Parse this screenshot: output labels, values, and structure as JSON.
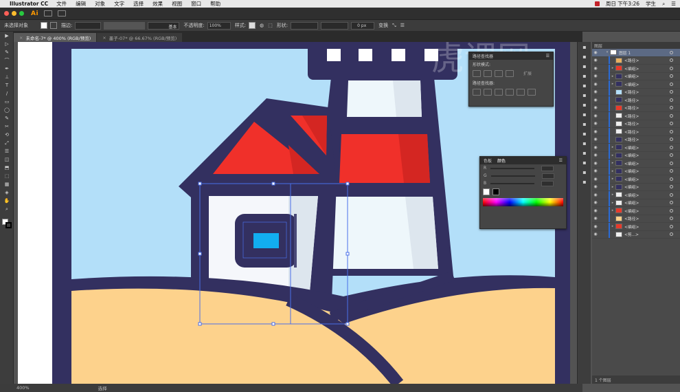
{
  "menubar": {
    "app_name": "Illustrator CC",
    "items": [
      "文件",
      "编辑",
      "对象",
      "文字",
      "选择",
      "效果",
      "视图",
      "窗口",
      "帮助"
    ],
    "clock": "周日 下午3:26",
    "user": "学生"
  },
  "appbar": {
    "logo": "Ai"
  },
  "control": {
    "no_selection": "未选择对象",
    "stroke_label": "描边:",
    "stroke_style": "基本",
    "opacity_label": "不透明度:",
    "opacity_value": "100%",
    "style_label": "样式:",
    "shape_label": "形状:",
    "px_value": "0 px",
    "transform_label": "变换"
  },
  "tabs": [
    {
      "label": "未命名-7* @ 400% (RGB/预览)",
      "active": true
    },
    {
      "label": "墨子-07* @ 66.67% (RGB/预览)",
      "active": false
    }
  ],
  "toolbar": {
    "tools": [
      "▶",
      "▷",
      "✎",
      "⌒",
      "✒",
      "⊥",
      "T",
      "/",
      "▭",
      "◯",
      "✎",
      "✂",
      "⟲",
      "⤢",
      "☰",
      "◫",
      "⬒",
      "⬚",
      "▦",
      "◈",
      "✋",
      "⌕"
    ]
  },
  "status": {
    "zoom": "400%",
    "mode": "选择"
  },
  "pathfinder": {
    "title": "路径查找器",
    "shape_modes": "形状模式:",
    "expand": "扩展",
    "pathfinders": "路径查找器:"
  },
  "color_panel": {
    "tab1": "色板",
    "tab2": "颜色",
    "slider_labels": [
      "R",
      "G",
      "B"
    ]
  },
  "layers": {
    "title": "图层",
    "top_layer": "图层 1",
    "items": [
      {
        "name": "<路径>",
        "thumb": "#e8b060"
      },
      {
        "name": "<编组>",
        "thumb": "#e83a2a"
      },
      {
        "name": "<编组>",
        "thumb": "#333060"
      },
      {
        "name": "<编组>",
        "thumb": "#333060"
      },
      {
        "name": "<路径>",
        "thumb": "#b3dff9"
      },
      {
        "name": "<路径>",
        "thumb": "#333060"
      },
      {
        "name": "<路径>",
        "thumb": "#e83a2a"
      },
      {
        "name": "<路径>",
        "thumb": "#eeeeee"
      },
      {
        "name": "<路径>",
        "thumb": "#eeeeee"
      },
      {
        "name": "<路径>",
        "thumb": "#eeeeee"
      },
      {
        "name": "<路径>",
        "thumb": "#333060"
      },
      {
        "name": "<编组>",
        "thumb": "#333060"
      },
      {
        "name": "<编组>",
        "thumb": "#333060"
      },
      {
        "name": "<编组>",
        "thumb": "#333060"
      },
      {
        "name": "<编组>",
        "thumb": "#333060"
      },
      {
        "name": "<编组>",
        "thumb": "#333060"
      },
      {
        "name": "<编组>",
        "thumb": "#333060"
      },
      {
        "name": "<编组>",
        "thumb": "#eeeeee"
      },
      {
        "name": "<编组>",
        "thumb": "#eeeeee"
      },
      {
        "name": "<编组>",
        "thumb": "#e83a2a"
      },
      {
        "name": "<路径>",
        "thumb": "#fdd28c"
      },
      {
        "name": "<编组>",
        "thumb": "#e83a2a"
      },
      {
        "name": "<剪...>",
        "thumb": "#eeeeee"
      }
    ],
    "footer": "1 个图层"
  },
  "colors": {
    "navy": "#333060",
    "sky": "#b3dff9",
    "red": "#f0302a",
    "red_dark": "#d42622",
    "sand": "#fdd28c",
    "white": "#f5f7fb",
    "shade": "#dde6ee",
    "cyan": "#12aef0",
    "selection": "#4a6fe8"
  },
  "watermark": "虎课网"
}
